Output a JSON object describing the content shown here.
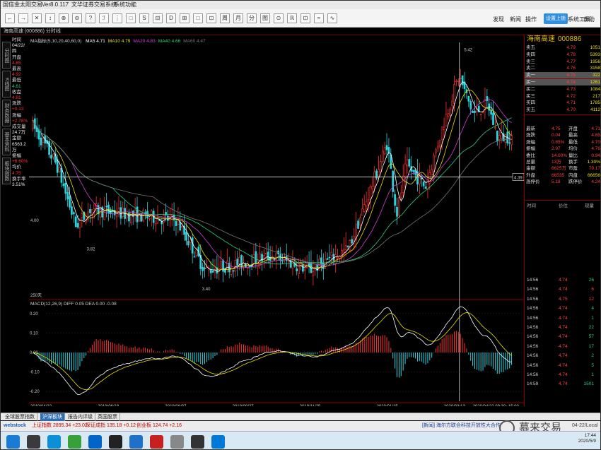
{
  "window": {
    "title": "国信金太阳交易",
    "version": "Ver8.0.117",
    "menu": [
      "文华证券交易系统",
      "系统功能"
    ]
  },
  "toolbar": {
    "buttons": [
      "←",
      "→",
      "✕",
      "↕",
      "⊕",
      "⊖",
      "?",
      "ℐ",
      "⋮",
      "□",
      "S",
      "⊟",
      "D",
      "⊞",
      "□",
      "⊡",
      "周",
      "月",
      "分",
      "图",
      "⊙",
      "ℝ",
      "⊡",
      "≈",
      "∿"
    ],
    "right_items": [
      "发现",
      "新闻",
      "操作",
      "设置上锁",
      "系统工具",
      "帮助"
    ]
  },
  "subbar": {
    "label": "海南高速 (000886) 分时线"
  },
  "left_tabs": [
    "分时图",
    "K线图",
    "财务数据",
    "基本资料",
    "板块指数"
  ],
  "info": [
    {
      "label": "时间",
      "value": "04/22/四",
      "cls": "wht"
    },
    {
      "label": "开盘",
      "value": "4.85",
      "cls": "red"
    },
    {
      "label": "最高",
      "value": "4.92",
      "cls": "red"
    },
    {
      "label": "最低",
      "value": "4.61",
      "cls": "grn"
    },
    {
      "label": "收盘",
      "value": "4.81",
      "cls": "red"
    },
    {
      "label": "涨跌",
      "value": "+0.13",
      "cls": "red"
    },
    {
      "label": "涨幅",
      "value": "+2.78%",
      "cls": "red"
    },
    {
      "label": "成交量",
      "value": "24.7万",
      "cls": "wht"
    },
    {
      "label": "金额",
      "value": "6563.2万",
      "cls": "wht"
    },
    {
      "label": "振幅",
      "value": "+6.60%",
      "cls": "red"
    },
    {
      "label": "均价",
      "value": "4.75",
      "cls": "red"
    },
    {
      "label": "换手率",
      "value": "3.51%",
      "cls": "wht"
    }
  ],
  "legend": {
    "ma_prefix": "MA指标(5,10,20,40,60,0)",
    "ma": [
      {
        "name": "MA5 4.71",
        "color": "#ffffff"
      },
      {
        "name": "MA10 4.79",
        "color": "#e8e000"
      },
      {
        "name": "MA20 4.83",
        "color": "#d040d0"
      },
      {
        "name": "MA40 4.66",
        "color": "#26d17a"
      },
      {
        "name": "MA60 4.47",
        "color": "#777777"
      }
    ],
    "macd": "MACD(12,26,9) DIFF 0.05 DEA 0.00 -0.08"
  },
  "chart_data": {
    "type": "candlestick",
    "price_ticks": [
      "4.00"
    ],
    "price_marks": [
      "5.42",
      "3.82",
      "3.40"
    ],
    "crosshair_price": "4.39",
    "bottom_left_note": "250天",
    "macd_ticks": [
      "0.20",
      "0.10",
      "0.00",
      "-0.10",
      "-0.20"
    ],
    "x_dates": [
      "2019/04/22",
      "2019/06/18",
      "2019/08/07",
      "2019/09/27",
      "2019/11/25",
      "2020/01/15",
      "2020/03/13",
      "2020/04/22 09:30~15:00"
    ],
    "price_ylim": [
      3.3,
      5.6
    ]
  },
  "stock": {
    "name": "海南高速",
    "code": "000886"
  },
  "order_book": [
    {
      "label": "卖五",
      "price": "4.79",
      "vol": "1051"
    },
    {
      "label": "卖四",
      "price": "4.78",
      "vol": "5393"
    },
    {
      "label": "卖三",
      "price": "4.77",
      "vol": "1956"
    },
    {
      "label": "卖二",
      "price": "4.76",
      "vol": "3158"
    },
    {
      "label": "卖一",
      "price": "4.75",
      "vol": "322"
    },
    {
      "label": "买一",
      "price": "4.74",
      "vol": "1261"
    },
    {
      "label": "买二",
      "price": "4.73",
      "vol": "1084"
    },
    {
      "label": "买三",
      "price": "4.72",
      "vol": "217"
    },
    {
      "label": "买四",
      "price": "4.71",
      "vol": "1785"
    },
    {
      "label": "买五",
      "price": "4.70",
      "vol": "4112"
    }
  ],
  "quote": [
    {
      "l1": "最新",
      "v1": "4.75",
      "l2": "开盘",
      "v2": "4.71"
    },
    {
      "l1": "涨跌",
      "v1": "0.04",
      "l2": "最高",
      "v2": "4.85"
    },
    {
      "l1": "涨幅",
      "v1": "0.85%",
      "l2": "最低",
      "v2": "4.70"
    },
    {
      "l1": "振幅",
      "v1": "2.97",
      "l2": "均价",
      "v2": "4.76"
    },
    {
      "l1": "委比",
      "v1": "14.00%",
      "l2": "量比",
      "v2": "0.94"
    },
    {
      "l1": "总量",
      "v1": "13万",
      "l2": "换手",
      "v2": "1.30%"
    },
    {
      "l1": "金额",
      "v1": "6625万",
      "l2": "市盈",
      "v2": "79.17"
    },
    {
      "l1": "外盘",
      "v1": "66535",
      "l2": "内盘",
      "v2": "66656"
    },
    {
      "l1": "涨停价",
      "v1": "5.18",
      "l2": "跌停价",
      "v2": "4.24"
    }
  ],
  "ticks_header": [
    "时间",
    "价位",
    "现量"
  ],
  "ticks": [
    {
      "t": "14:56",
      "p": "4.74",
      "v": "26",
      "c": "#26d17a"
    },
    {
      "t": "14:56",
      "p": "4.74",
      "v": "6",
      "c": "#ff4040"
    },
    {
      "t": "14:56",
      "p": "4.75",
      "v": "12",
      "c": "#ff4040"
    },
    {
      "t": "14:56",
      "p": "4.74",
      "v": "4",
      "c": "#26d17a"
    },
    {
      "t": "14:56",
      "p": "4.74",
      "v": "1",
      "c": "#26d17a"
    },
    {
      "t": "14:56",
      "p": "4.74",
      "v": "22",
      "c": "#26d17a"
    },
    {
      "t": "14:56",
      "p": "4.74",
      "v": "57",
      "c": "#26d17a"
    },
    {
      "t": "14:56",
      "p": "4.74",
      "v": "17",
      "c": "#26d17a"
    },
    {
      "t": "14:56",
      "p": "4.74",
      "v": "2",
      "c": "#26d17a"
    },
    {
      "t": "14:56",
      "p": "4.74",
      "v": "5",
      "c": "#26d17a"
    },
    {
      "t": "14:56",
      "p": "4.74",
      "v": "1",
      "c": "#26d17a"
    },
    {
      "t": "14:59",
      "p": "4.74",
      "v": "1501",
      "c": "#26d17a"
    }
  ],
  "bottom_tabs": [
    "全球股票指数",
    "沪深板块",
    "报告内评级",
    "英国股票"
  ],
  "status": {
    "sh_index": "上证指数 2895.34 +23.02",
    "sz_index": "深证成指 135.18 +0.12",
    "cy_index": "创业板 124.74 +2.16",
    "news": "[新闻] 海尔方联合科技开放性大合作",
    "right_text": "04-22/Local"
  },
  "watermark": "慕来交易",
  "clock": {
    "time": "17:44",
    "date": "2020/5/9"
  },
  "colors": {
    "up": "#ff3030",
    "down": "#26d7e0",
    "accent": "#8b0000"
  }
}
